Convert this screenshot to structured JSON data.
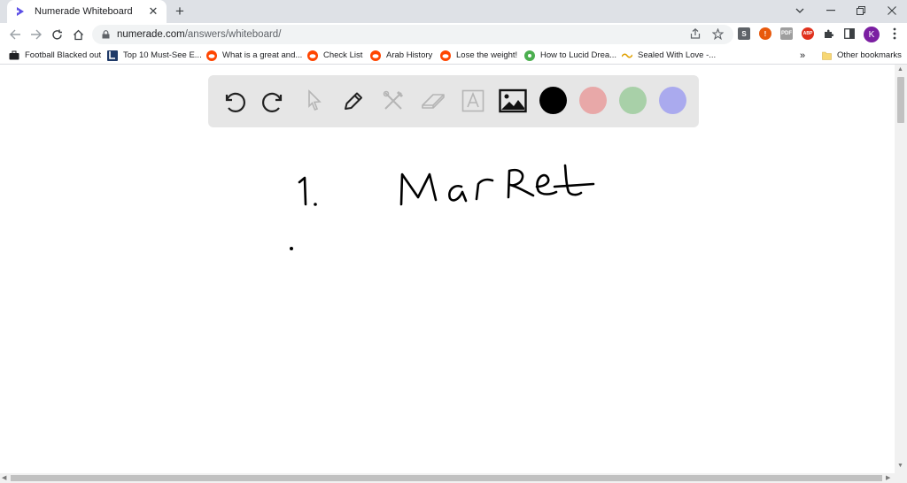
{
  "tab": {
    "title": "Numerade Whiteboard",
    "favicon": "numerade-logo-icon"
  },
  "address": {
    "host": "numerade.com",
    "path": "/answers/whiteboard/"
  },
  "profile": {
    "initial": "K",
    "color": "#7b1fa2"
  },
  "bookmarks": [
    {
      "label": "Football Blacked out",
      "icon": "briefcase-icon"
    },
    {
      "label": "Top 10 Must-See E...",
      "icon": "site-icon"
    },
    {
      "label": "What is a great and...",
      "icon": "reddit-icon"
    },
    {
      "label": "Check List",
      "icon": "reddit-icon"
    },
    {
      "label": "Arab History",
      "icon": "reddit-icon"
    },
    {
      "label": "Lose the weight!",
      "icon": "reddit-icon"
    },
    {
      "label": "How to Lucid Drea...",
      "icon": "site-icon"
    },
    {
      "label": "Sealed With Love -...",
      "icon": "site-icon"
    }
  ],
  "other_bookmarks": "Other bookmarks",
  "whiteboard": {
    "tools": [
      "undo-icon",
      "redo-icon",
      "select-arrow-icon",
      "pen-icon",
      "tools-icon",
      "eraser-icon",
      "text-icon",
      "image-icon"
    ],
    "colors": [
      "#000000",
      "#e8a8a8",
      "#a8d0a8",
      "#aaaaee"
    ],
    "handwriting": "1. Marret"
  }
}
